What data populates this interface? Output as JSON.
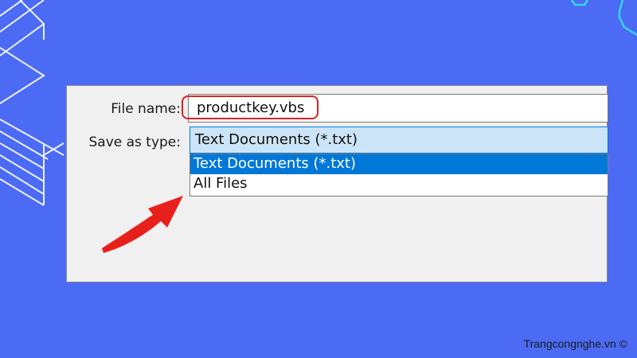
{
  "dialog": {
    "file_name_label": "File name:",
    "file_name_value": "productkey.vbs",
    "save_as_type_label": "Save as type:",
    "save_as_type_value": "Text Documents (*.txt)",
    "type_options": [
      "Text Documents (*.txt)",
      "All Files"
    ]
  },
  "annotations": {
    "highlight_color": "#e02020",
    "arrow_color": "#e02020"
  },
  "watermark": "Trangcongnghe.vn ©",
  "colors": {
    "background": "#4b6bf5",
    "selection": "#0078d7",
    "select_fill": "#cce4f7"
  }
}
